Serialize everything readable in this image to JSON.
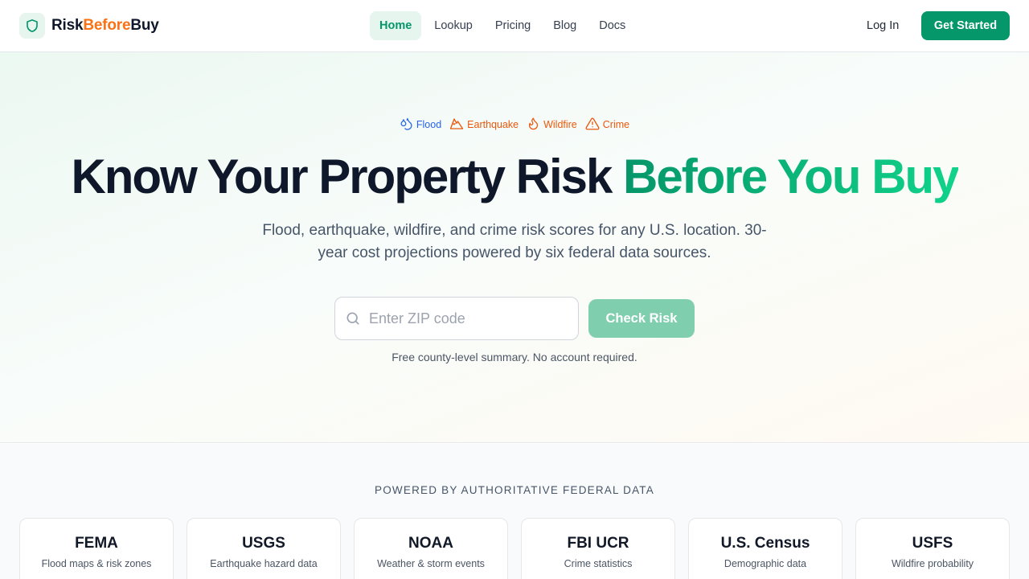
{
  "brand": {
    "name_part1": "Risk",
    "name_part2": "Before",
    "name_part3": "Buy",
    "accent_color": "#059669",
    "secondary_color": "#f97316",
    "icon": "shield-icon"
  },
  "nav": {
    "links": [
      {
        "label": "Home",
        "active": true
      },
      {
        "label": "Lookup",
        "active": false
      },
      {
        "label": "Pricing",
        "active": false
      },
      {
        "label": "Blog",
        "active": false
      },
      {
        "label": "Docs",
        "active": false
      }
    ],
    "login_label": "Log In",
    "cta_label": "Get Started"
  },
  "hero": {
    "tags": [
      {
        "label": "Flood",
        "icon": "droplets-icon",
        "color": "#2563eb"
      },
      {
        "label": "Earthquake",
        "icon": "mountain-icon",
        "color": "#ea580c"
      },
      {
        "label": "Wildfire",
        "icon": "flame-icon",
        "color": "#ea580c"
      },
      {
        "label": "Crime",
        "icon": "warning-triangle-icon",
        "color": "#ea580c"
      }
    ],
    "headline_main": "Know Your Property Risk ",
    "headline_accent": "Before You Buy",
    "subtitle": "Flood, earthquake, wildfire, and crime risk scores for any U.S. location. 30-year cost projections powered by six federal data sources.",
    "search": {
      "placeholder": "Enter ZIP code",
      "value": "",
      "icon": "search-icon"
    },
    "check_label": "Check Risk",
    "note": "Free county-level summary. No account required."
  },
  "sources": {
    "title": "POWERED BY AUTHORITATIVE FEDERAL DATA",
    "items": [
      {
        "name": "FEMA",
        "desc": "Flood maps & risk zones"
      },
      {
        "name": "USGS",
        "desc": "Earthquake hazard data"
      },
      {
        "name": "NOAA",
        "desc": "Weather & storm events"
      },
      {
        "name": "FBI UCR",
        "desc": "Crime statistics"
      },
      {
        "name": "U.S. Census",
        "desc": "Demographic data"
      },
      {
        "name": "USFS",
        "desc": "Wildfire probability"
      }
    ]
  }
}
